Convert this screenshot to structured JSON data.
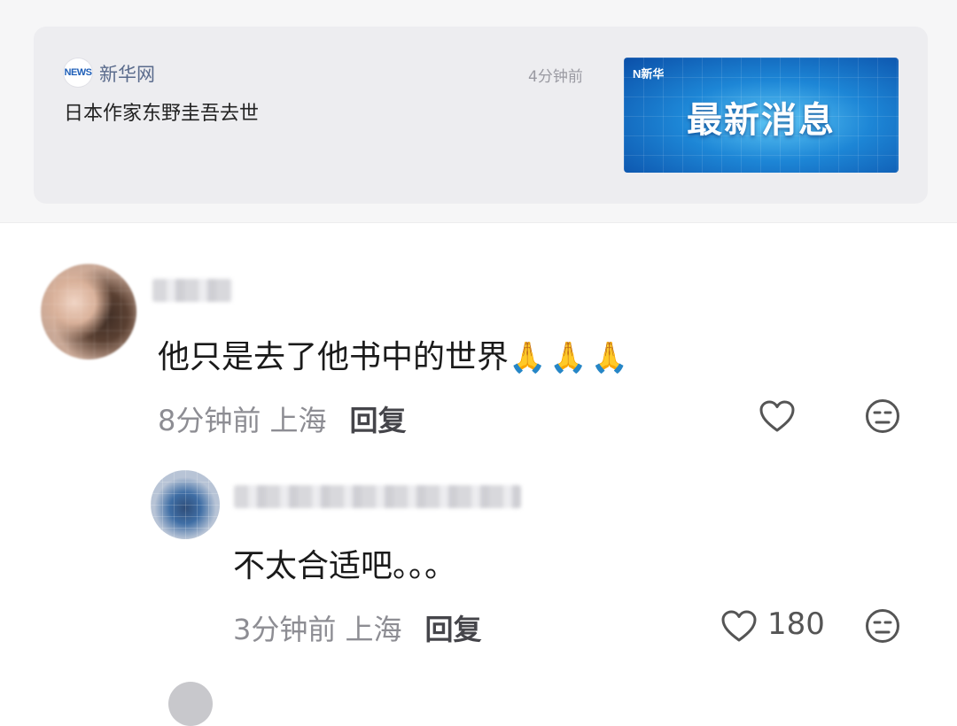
{
  "news_card": {
    "source_logo_text": "NEWS",
    "source_name": "新华网",
    "time": "4分钟前",
    "title": "日本作家东野圭吾去世",
    "thumbnail": {
      "mark": "N新华",
      "headline": "最新消息",
      "accent": "#1d86d6"
    }
  },
  "comments": [
    {
      "text": "他只是去了他书中的世界",
      "emoji": "🙏🙏🙏",
      "meta": "8分钟前 上海",
      "reply_label": "回复",
      "like_icon": "heart-outline-icon",
      "dislike_icon": "meh-face-icon"
    },
    {
      "text": "不太合适吧。。。",
      "meta": "3分钟前 上海",
      "reply_label": "回复",
      "like_count": "180",
      "like_icon": "heart-outline-icon",
      "dislike_icon": "meh-face-icon"
    }
  ],
  "colors": {
    "meta_gray": "#8d8d93",
    "card_bg": "#ededf0",
    "text_dark": "#1a1a1a"
  }
}
